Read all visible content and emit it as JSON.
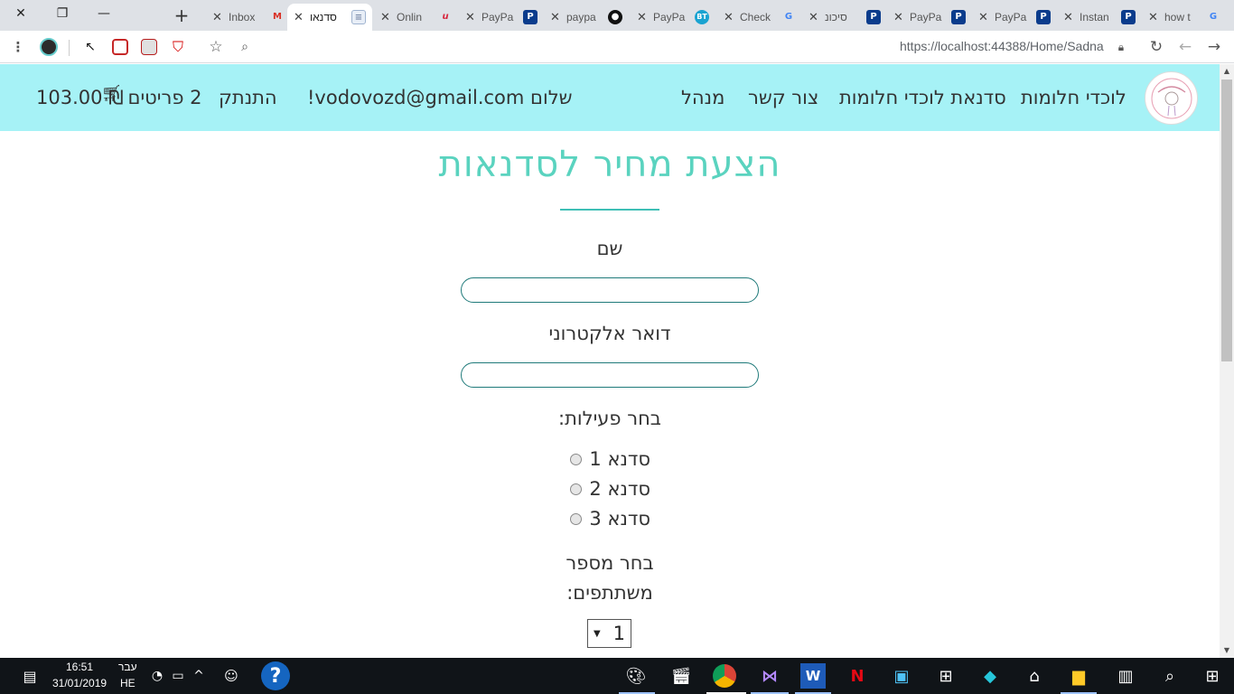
{
  "browser": {
    "tabs": [
      {
        "title": "Inbox",
        "favicon": "gmail-icon",
        "active": false
      },
      {
        "title": "סדנאו",
        "favicon": "page-icon",
        "active": true
      },
      {
        "title": "Onlin",
        "favicon": "u-icon",
        "active": false
      },
      {
        "title": "PayPa",
        "favicon": "paypal-icon",
        "active": false
      },
      {
        "title": "paypa",
        "favicon": "github-icon",
        "active": false
      },
      {
        "title": "PayPa",
        "favicon": "bt-icon",
        "active": false
      },
      {
        "title": "Check",
        "favicon": "google-icon",
        "active": false
      },
      {
        "title": "סיכונ",
        "favicon": "paypal-icon",
        "active": false
      },
      {
        "title": "PayPa",
        "favicon": "paypal-icon",
        "active": false
      },
      {
        "title": "PayPa",
        "favicon": "paypal-icon",
        "active": false
      },
      {
        "title": "Instan",
        "favicon": "paypal-icon",
        "active": false
      },
      {
        "title": "how t",
        "favicon": "google-icon",
        "active": false
      }
    ],
    "url": "https://localhost:44388/Home/Sadna"
  },
  "nav": {
    "site_name": "לוכדי חלומות",
    "workshop": "סדנאת לוכדי חלומות",
    "contact": "צור קשר",
    "admin": "מנהל",
    "greeting": "שלום vodovozd@gmail.com!",
    "logout": "התנתק",
    "cart_count": "2 פריטים",
    "cart_total": "103.00 ₪"
  },
  "form": {
    "title": "הצעת מחיר לסדנאות",
    "name_label": "שם",
    "email_label": "דואר אלקטרוני",
    "activity_label": "בחר פעילות:",
    "options": [
      "סדנא 1",
      "סדנא 2",
      "סדנא 3"
    ],
    "participants_label_line1": "בחר מספר",
    "participants_label_line2": "משתתפים:",
    "participants_value": "1"
  },
  "taskbar": {
    "time": "16:51",
    "date": "31/01/2019",
    "lang_top": "עבר",
    "lang_bottom": "HE"
  }
}
